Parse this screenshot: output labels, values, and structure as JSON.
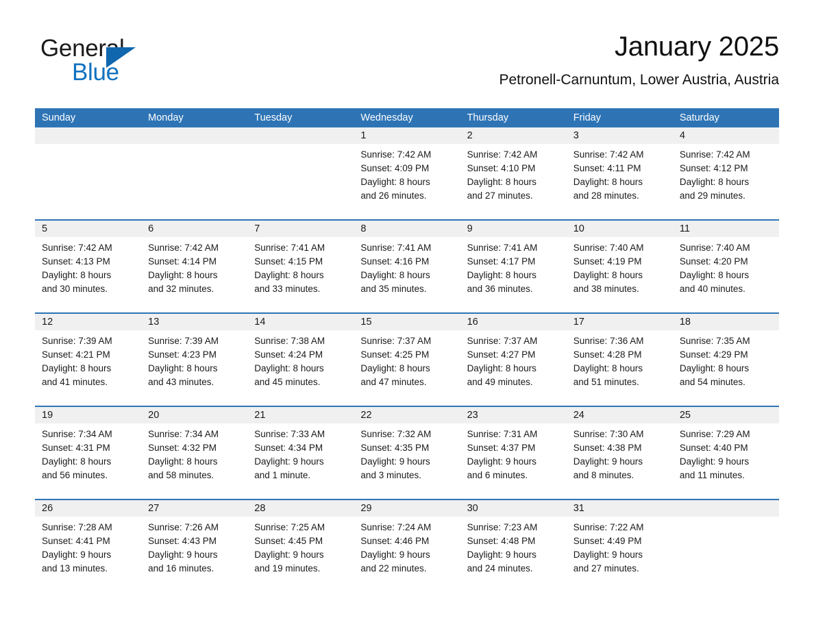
{
  "brand": {
    "line1": "General",
    "line2": "Blue",
    "flag_color": "#1167ae",
    "blue_text_color": "#1072c0"
  },
  "header": {
    "month_title": "January 2025",
    "location": "Petronell-Carnuntum, Lower Austria, Austria"
  },
  "theme": {
    "header_blue": "#2e74b5",
    "date_band_gray": "#f0f0f0",
    "text_color": "#1a1a1a"
  },
  "weekdays": [
    "Sunday",
    "Monday",
    "Tuesday",
    "Wednesday",
    "Thursday",
    "Friday",
    "Saturday"
  ],
  "weeks": [
    [
      {
        "day": "",
        "lines": []
      },
      {
        "day": "",
        "lines": []
      },
      {
        "day": "",
        "lines": []
      },
      {
        "day": "1",
        "lines": [
          "Sunrise: 7:42 AM",
          "Sunset: 4:09 PM",
          "Daylight: 8 hours",
          "and 26 minutes."
        ]
      },
      {
        "day": "2",
        "lines": [
          "Sunrise: 7:42 AM",
          "Sunset: 4:10 PM",
          "Daylight: 8 hours",
          "and 27 minutes."
        ]
      },
      {
        "day": "3",
        "lines": [
          "Sunrise: 7:42 AM",
          "Sunset: 4:11 PM",
          "Daylight: 8 hours",
          "and 28 minutes."
        ]
      },
      {
        "day": "4",
        "lines": [
          "Sunrise: 7:42 AM",
          "Sunset: 4:12 PM",
          "Daylight: 8 hours",
          "and 29 minutes."
        ]
      }
    ],
    [
      {
        "day": "5",
        "lines": [
          "Sunrise: 7:42 AM",
          "Sunset: 4:13 PM",
          "Daylight: 8 hours",
          "and 30 minutes."
        ]
      },
      {
        "day": "6",
        "lines": [
          "Sunrise: 7:42 AM",
          "Sunset: 4:14 PM",
          "Daylight: 8 hours",
          "and 32 minutes."
        ]
      },
      {
        "day": "7",
        "lines": [
          "Sunrise: 7:41 AM",
          "Sunset: 4:15 PM",
          "Daylight: 8 hours",
          "and 33 minutes."
        ]
      },
      {
        "day": "8",
        "lines": [
          "Sunrise: 7:41 AM",
          "Sunset: 4:16 PM",
          "Daylight: 8 hours",
          "and 35 minutes."
        ]
      },
      {
        "day": "9",
        "lines": [
          "Sunrise: 7:41 AM",
          "Sunset: 4:17 PM",
          "Daylight: 8 hours",
          "and 36 minutes."
        ]
      },
      {
        "day": "10",
        "lines": [
          "Sunrise: 7:40 AM",
          "Sunset: 4:19 PM",
          "Daylight: 8 hours",
          "and 38 minutes."
        ]
      },
      {
        "day": "11",
        "lines": [
          "Sunrise: 7:40 AM",
          "Sunset: 4:20 PM",
          "Daylight: 8 hours",
          "and 40 minutes."
        ]
      }
    ],
    [
      {
        "day": "12",
        "lines": [
          "Sunrise: 7:39 AM",
          "Sunset: 4:21 PM",
          "Daylight: 8 hours",
          "and 41 minutes."
        ]
      },
      {
        "day": "13",
        "lines": [
          "Sunrise: 7:39 AM",
          "Sunset: 4:23 PM",
          "Daylight: 8 hours",
          "and 43 minutes."
        ]
      },
      {
        "day": "14",
        "lines": [
          "Sunrise: 7:38 AM",
          "Sunset: 4:24 PM",
          "Daylight: 8 hours",
          "and 45 minutes."
        ]
      },
      {
        "day": "15",
        "lines": [
          "Sunrise: 7:37 AM",
          "Sunset: 4:25 PM",
          "Daylight: 8 hours",
          "and 47 minutes."
        ]
      },
      {
        "day": "16",
        "lines": [
          "Sunrise: 7:37 AM",
          "Sunset: 4:27 PM",
          "Daylight: 8 hours",
          "and 49 minutes."
        ]
      },
      {
        "day": "17",
        "lines": [
          "Sunrise: 7:36 AM",
          "Sunset: 4:28 PM",
          "Daylight: 8 hours",
          "and 51 minutes."
        ]
      },
      {
        "day": "18",
        "lines": [
          "Sunrise: 7:35 AM",
          "Sunset: 4:29 PM",
          "Daylight: 8 hours",
          "and 54 minutes."
        ]
      }
    ],
    [
      {
        "day": "19",
        "lines": [
          "Sunrise: 7:34 AM",
          "Sunset: 4:31 PM",
          "Daylight: 8 hours",
          "and 56 minutes."
        ]
      },
      {
        "day": "20",
        "lines": [
          "Sunrise: 7:34 AM",
          "Sunset: 4:32 PM",
          "Daylight: 8 hours",
          "and 58 minutes."
        ]
      },
      {
        "day": "21",
        "lines": [
          "Sunrise: 7:33 AM",
          "Sunset: 4:34 PM",
          "Daylight: 9 hours",
          "and 1 minute."
        ]
      },
      {
        "day": "22",
        "lines": [
          "Sunrise: 7:32 AM",
          "Sunset: 4:35 PM",
          "Daylight: 9 hours",
          "and 3 minutes."
        ]
      },
      {
        "day": "23",
        "lines": [
          "Sunrise: 7:31 AM",
          "Sunset: 4:37 PM",
          "Daylight: 9 hours",
          "and 6 minutes."
        ]
      },
      {
        "day": "24",
        "lines": [
          "Sunrise: 7:30 AM",
          "Sunset: 4:38 PM",
          "Daylight: 9 hours",
          "and 8 minutes."
        ]
      },
      {
        "day": "25",
        "lines": [
          "Sunrise: 7:29 AM",
          "Sunset: 4:40 PM",
          "Daylight: 9 hours",
          "and 11 minutes."
        ]
      }
    ],
    [
      {
        "day": "26",
        "lines": [
          "Sunrise: 7:28 AM",
          "Sunset: 4:41 PM",
          "Daylight: 9 hours",
          "and 13 minutes."
        ]
      },
      {
        "day": "27",
        "lines": [
          "Sunrise: 7:26 AM",
          "Sunset: 4:43 PM",
          "Daylight: 9 hours",
          "and 16 minutes."
        ]
      },
      {
        "day": "28",
        "lines": [
          "Sunrise: 7:25 AM",
          "Sunset: 4:45 PM",
          "Daylight: 9 hours",
          "and 19 minutes."
        ]
      },
      {
        "day": "29",
        "lines": [
          "Sunrise: 7:24 AM",
          "Sunset: 4:46 PM",
          "Daylight: 9 hours",
          "and 22 minutes."
        ]
      },
      {
        "day": "30",
        "lines": [
          "Sunrise: 7:23 AM",
          "Sunset: 4:48 PM",
          "Daylight: 9 hours",
          "and 24 minutes."
        ]
      },
      {
        "day": "31",
        "lines": [
          "Sunrise: 7:22 AM",
          "Sunset: 4:49 PM",
          "Daylight: 9 hours",
          "and 27 minutes."
        ]
      },
      {
        "day": "",
        "lines": []
      }
    ]
  ]
}
